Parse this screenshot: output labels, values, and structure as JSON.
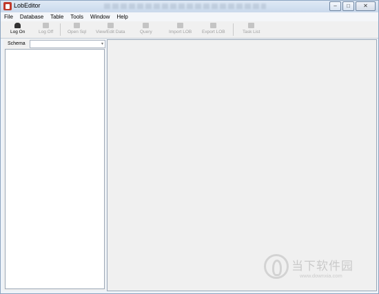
{
  "window": {
    "title": "LobEditor",
    "controls": {
      "minimize": "–",
      "maximize": "□",
      "close": "✕"
    }
  },
  "menu": {
    "items": [
      "File",
      "Database",
      "Table",
      "Tools",
      "Window",
      "Help"
    ]
  },
  "toolbar": {
    "buttons": [
      {
        "label": "Log On",
        "enabled": true,
        "icon": "log-on-icon"
      },
      {
        "label": "Log Off",
        "enabled": false,
        "icon": "log-off-icon"
      },
      {
        "label": "Open Sql",
        "enabled": false,
        "icon": "open-sql-icon"
      },
      {
        "label": "View/Edit Data",
        "enabled": false,
        "icon": "view-edit-icon"
      },
      {
        "label": "Query",
        "enabled": false,
        "icon": "query-icon"
      },
      {
        "label": "Import LOB",
        "enabled": false,
        "icon": "import-icon"
      },
      {
        "label": "Export LOB",
        "enabled": false,
        "icon": "export-icon"
      },
      {
        "label": "Task List",
        "enabled": false,
        "icon": "task-list-icon"
      }
    ]
  },
  "left_panel": {
    "schema_label": "Schema",
    "schema_value": ""
  },
  "watermark": {
    "text": "当下软件园",
    "url": "www.downxia.com"
  },
  "colors": {
    "title_bar": "#c9d9ec",
    "toolbar_bg": "#f0f0f0",
    "disabled_text": "#a0a0a0"
  }
}
